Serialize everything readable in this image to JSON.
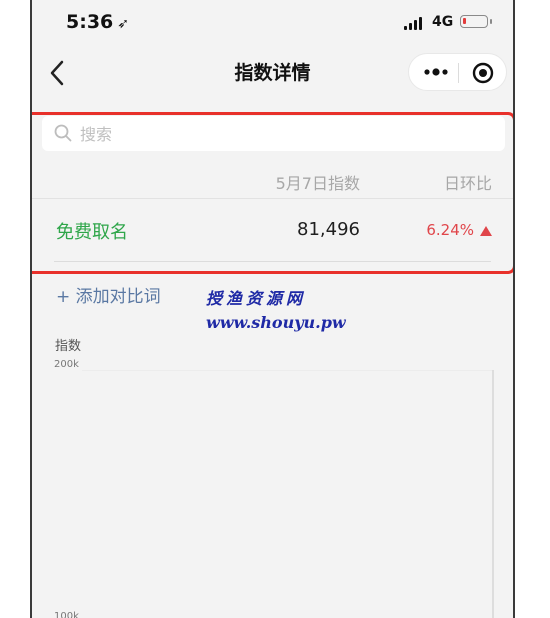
{
  "status_bar": {
    "time": "5:36",
    "location_glyph": "➶",
    "network": "4G",
    "battery_color": "#e23b3b"
  },
  "nav": {
    "title": "指数详情",
    "back_icon": "chevron-left-icon",
    "more_icon": "more-dots-icon",
    "close_icon": "target-circle-icon"
  },
  "search": {
    "placeholder": "搜索",
    "value": ""
  },
  "table": {
    "columns": [
      "5月7日指数",
      "日环比"
    ],
    "rows": [
      {
        "keyword": "免费取名",
        "value": "81,496",
        "change": "6.24%",
        "trend": "up"
      }
    ]
  },
  "add_compare_label": "+ 添加对比词",
  "watermark": {
    "title": "授渔资源网",
    "url": "www.shouyu.pw"
  },
  "colors": {
    "accent_green": "#2fa64a",
    "up_red": "#e0454a",
    "highlight_border": "#e8302a",
    "link_blue": "#5a78a3"
  },
  "chart_data": {
    "type": "line",
    "ylabel": "指数",
    "yticks": [
      "200k",
      "100k"
    ],
    "series": []
  }
}
